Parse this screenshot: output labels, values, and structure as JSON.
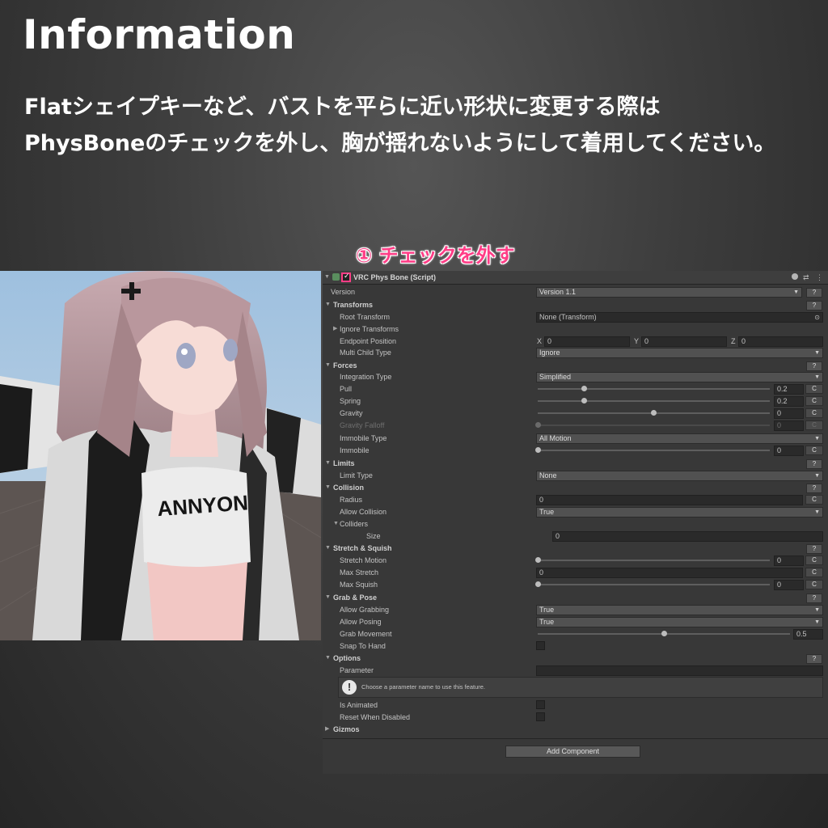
{
  "title": "Information",
  "description": {
    "line1": "Flatシェイプキーなど、バストを平らに近い形状に変更する際は",
    "line2": "PhysBoneのチェックを外し、胸が揺れないようにして着用してください。"
  },
  "callout": "① チェックを外す",
  "shirt_text": "ANNYON",
  "inspector": {
    "component_title": "VRC Phys Bone (Script)",
    "version": {
      "label": "Version",
      "value": "Version 1.1"
    },
    "transforms": {
      "header": "Transforms",
      "root_transform": {
        "label": "Root Transform",
        "value": "None (Transform)"
      },
      "ignore_transforms": "Ignore Transforms",
      "endpoint_position": {
        "label": "Endpoint Position",
        "x": "0",
        "y": "0",
        "z": "0",
        "x_label": "X",
        "y_label": "Y",
        "z_label": "Z"
      },
      "multi_child_type": {
        "label": "Multi Child Type",
        "value": "Ignore"
      }
    },
    "forces": {
      "header": "Forces",
      "integration_type": {
        "label": "Integration Type",
        "value": "Simplified"
      },
      "pull": {
        "label": "Pull",
        "value": "0.2",
        "fraction": 0.2
      },
      "spring": {
        "label": "Spring",
        "value": "0.2",
        "fraction": 0.2
      },
      "gravity": {
        "label": "Gravity",
        "value": "0",
        "fraction": 0.5
      },
      "gravity_falloff": {
        "label": "Gravity Falloff",
        "value": "0",
        "fraction": 0.0
      },
      "immobile_type": {
        "label": "Immobile Type",
        "value": "All Motion"
      },
      "immobile": {
        "label": "Immobile",
        "value": "0",
        "fraction": 0.0
      }
    },
    "limits": {
      "header": "Limits",
      "limit_type": {
        "label": "Limit Type",
        "value": "None"
      }
    },
    "collision": {
      "header": "Collision",
      "radius": {
        "label": "Radius",
        "value": "0"
      },
      "allow_collision": {
        "label": "Allow Collision",
        "value": "True"
      },
      "colliders": "Colliders",
      "size": {
        "label": "Size",
        "value": "0"
      }
    },
    "stretch_squish": {
      "header": "Stretch & Squish",
      "stretch_motion": {
        "label": "Stretch Motion",
        "value": "0",
        "fraction": 0.0
      },
      "max_stretch": {
        "label": "Max Stretch",
        "value": "0"
      },
      "max_squish": {
        "label": "Max Squish",
        "value": "0",
        "fraction": 0.0
      }
    },
    "grab_pose": {
      "header": "Grab & Pose",
      "allow_grabbing": {
        "label": "Allow Grabbing",
        "value": "True"
      },
      "allow_posing": {
        "label": "Allow Posing",
        "value": "True"
      },
      "grab_movement": {
        "label": "Grab Movement",
        "value": "0.5",
        "fraction": 0.5
      },
      "snap_to_hand": "Snap To Hand"
    },
    "options": {
      "header": "Options",
      "parameter": "Parameter",
      "help_text": "Choose a parameter name to use this feature.",
      "is_animated": "Is Animated",
      "reset_when_disabled": "Reset When Disabled"
    },
    "gizmos": "Gizmos",
    "add_component": "Add Component",
    "help_glyph": "?",
    "c_glyph": "C",
    "dropdown_arrow": "▼"
  },
  "colors": {
    "accent": "#ff3d86",
    "panel": "#383838"
  }
}
